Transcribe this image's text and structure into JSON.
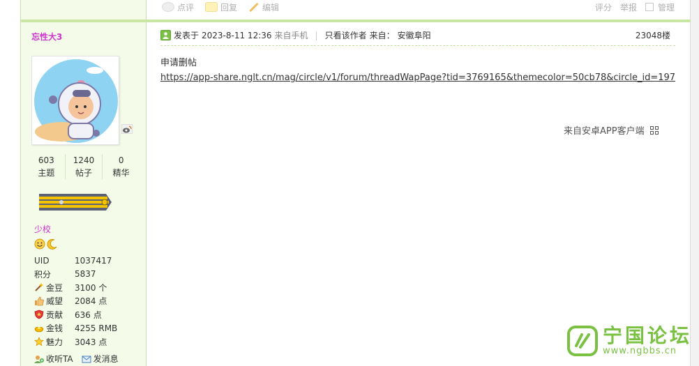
{
  "prev": {
    "actions": [
      {
        "label": "点评",
        "icon": "comment-eye-icon"
      },
      {
        "label": "回复",
        "icon": "reply-icon"
      },
      {
        "label": "编辑",
        "icon": "edit-pencil-icon"
      }
    ],
    "right": [
      "评分",
      "举报",
      "管理"
    ]
  },
  "user": {
    "name": "忘性大3",
    "stats": [
      {
        "value": "603",
        "label": "主题"
      },
      {
        "value": "1240",
        "label": "帖子"
      },
      {
        "value": "0",
        "label": "精华"
      }
    ],
    "rank": "少校",
    "info": [
      {
        "key": "UID",
        "value": "1037417",
        "icon": ""
      },
      {
        "key": "积分",
        "value": "5837",
        "icon": ""
      },
      {
        "key": "金豆",
        "value": "3100 个",
        "icon": "wand-icon"
      },
      {
        "key": "威望",
        "value": "2084 点",
        "icon": "thumbs-up-icon"
      },
      {
        "key": "贡献",
        "value": "636 点",
        "icon": "shield-icon"
      },
      {
        "key": "金钱",
        "value": "4255 RMB",
        "icon": "gold-ingot-icon"
      },
      {
        "key": "魅力",
        "value": "3043 点",
        "icon": "star-icon"
      }
    ],
    "follow": "收听TA",
    "message": "发消息"
  },
  "post": {
    "posted_prefix": "发表于",
    "datetime": "2023-8-11 12:36",
    "source": "来自手机",
    "author_only": "只看该作者",
    "from_label": "来自：",
    "location": "安徽阜阳",
    "floor": "23048楼",
    "title_line": "申请删帖",
    "link": "https://app-share.nglt.cn/mag/circle/v1/forum/threadWapPage?tid=3769165&themecolor=50cb78&circle_id=197",
    "client": "来自安卓APP客户端"
  },
  "watermark": {
    "cn": "宁国论坛",
    "en": "www.ngbbs.cn"
  },
  "colors": {
    "accent_green": "#7ac143",
    "username": "#cc33cc",
    "sidebar_bg": "#f4fbe9"
  }
}
